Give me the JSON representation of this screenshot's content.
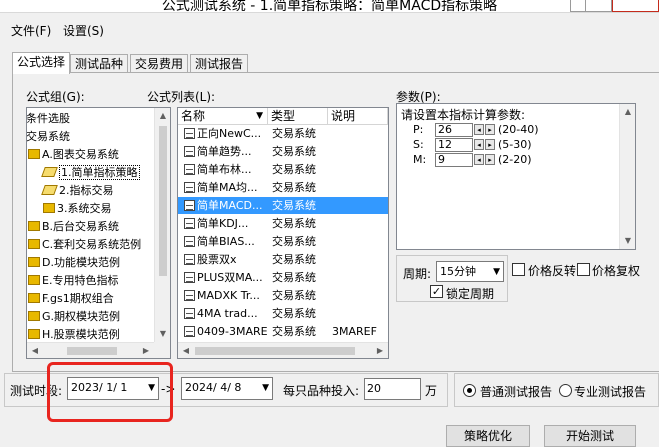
{
  "window": {
    "title": "公式测试系统 - 1.简单指标策略：简单MACD指标策略"
  },
  "menu": {
    "file": "文件(F)",
    "settings": "设置(S)"
  },
  "tabs": [
    {
      "label": "公式选择"
    },
    {
      "label": "测试品种"
    },
    {
      "label": "交易费用"
    },
    {
      "label": "测试报告"
    }
  ],
  "formula_group": {
    "label": "公式组(G):",
    "items": [
      {
        "label": "条件选股"
      },
      {
        "label": "交易系统"
      },
      {
        "label": "A.图表交易系统"
      },
      {
        "label": "1.简单指标策略"
      },
      {
        "label": "2.指标交易"
      },
      {
        "label": "3.系统交易"
      },
      {
        "label": "B.后台交易系统"
      },
      {
        "label": "C.套利交易系统范例"
      },
      {
        "label": "D.功能模块范例"
      },
      {
        "label": "E.专用特色指标"
      },
      {
        "label": "F.gs1期权组合"
      },
      {
        "label": "G.期权模块范例"
      },
      {
        "label": "H.股票模块范例"
      }
    ]
  },
  "formula_list": {
    "label": "公式列表(L):",
    "headers": {
      "name": "名称",
      "type": "类型",
      "desc": "说明"
    },
    "rows": [
      {
        "name": "正向NewC...",
        "type": "交易系统",
        "desc": ""
      },
      {
        "name": "简单趋势...",
        "type": "交易系统",
        "desc": ""
      },
      {
        "name": "简单布林...",
        "type": "交易系统",
        "desc": ""
      },
      {
        "name": "简单MA均...",
        "type": "交易系统",
        "desc": ""
      },
      {
        "name": "简单MACD...",
        "type": "交易系统",
        "desc": ""
      },
      {
        "name": "简单KDJ...",
        "type": "交易系统",
        "desc": ""
      },
      {
        "name": "简单BIAS...",
        "type": "交易系统",
        "desc": ""
      },
      {
        "name": "股票双x",
        "type": "交易系统",
        "desc": ""
      },
      {
        "name": "PLUS双MA...",
        "type": "交易系统",
        "desc": ""
      },
      {
        "name": "MADXK Tr...",
        "type": "交易系统",
        "desc": ""
      },
      {
        "name": "4MA trad...",
        "type": "交易系统",
        "desc": ""
      },
      {
        "name": "0409-3MAREF",
        "type": "交易系统",
        "desc": "3MAREF"
      }
    ]
  },
  "params": {
    "label": "参数(P):",
    "heading": "请设置本指标计算参数:",
    "rows": [
      {
        "name": "P:",
        "value": "26",
        "range": "(20-40)"
      },
      {
        "name": "S:",
        "value": "12",
        "range": "(5-30)"
      },
      {
        "name": "M:",
        "value": "9",
        "range": "(2-20)"
      }
    ]
  },
  "period": {
    "label": "周期:",
    "value": "15分钟",
    "price_reverse": "价格反转",
    "price_restore": "价格复权",
    "lock_period": "锁定周期"
  },
  "test_time": {
    "label": "测试时段:",
    "start": "2023/ 1/ 1",
    "arrow": "->",
    "end": "2024/ 4/ 8"
  },
  "invest": {
    "label": "每只品种投入:",
    "value": "20",
    "unit": "万"
  },
  "report": {
    "normal": "普通测试报告",
    "pro": "专业测试报告"
  },
  "buttons": {
    "optimize": "策略优化",
    "start": "开始测试"
  }
}
